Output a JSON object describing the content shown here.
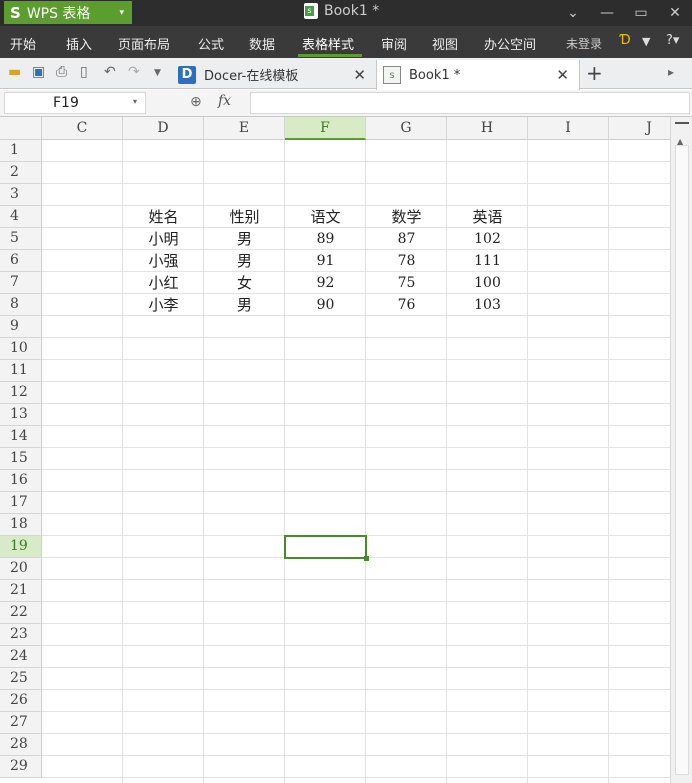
{
  "titlebar": {
    "app_logo": "S",
    "app_name": "WPS 表格",
    "app_caret": "▾",
    "doc_title": "Book1 *",
    "ctrl_dropdown": "⌄",
    "ctrl_minimize": "—",
    "ctrl_maximize": "▭",
    "ctrl_close": "✕"
  },
  "menu": {
    "items": [
      "开始",
      "插入",
      "页面布局",
      "公式",
      "数据",
      "表格样式",
      "审阅",
      "视图",
      "办公空间"
    ],
    "active": "表格样式",
    "login": "未登录",
    "skin_icon": "Ɗ",
    "shirt_icon": "👕",
    "help": "?▾"
  },
  "toolbar": {
    "qa_icons": [
      "folder-icon",
      "save-icon",
      "print-icon",
      "print-preview-icon",
      "undo-icon",
      "redo-icon",
      "dropdown-icon"
    ],
    "tabs": [
      {
        "label": "Docer-在线模板",
        "icon": "D",
        "close": "✕"
      },
      {
        "label": "Book1 *",
        "icon": "s",
        "close": "✕"
      }
    ],
    "new_tab": "+",
    "right_icon": "▸"
  },
  "formula_bar": {
    "name_box": "F19",
    "caret": "▾",
    "zoom_icon": "🔍",
    "fx": "fx",
    "formula": ""
  },
  "sheet": {
    "columns": [
      "C",
      "D",
      "E",
      "F",
      "G",
      "H",
      "I",
      "J"
    ],
    "selected_column": "F",
    "rows": [
      "1",
      "2",
      "3",
      "4",
      "5",
      "6",
      "7",
      "8",
      "9",
      "10",
      "11",
      "12",
      "13",
      "14",
      "15",
      "16",
      "17",
      "18",
      "19",
      "20",
      "21",
      "22",
      "23",
      "24",
      "25",
      "26",
      "27",
      "28",
      "29"
    ],
    "selected_row": "19",
    "table": {
      "headers": [
        "姓名",
        "性别",
        "语文",
        "数学",
        "英语"
      ],
      "rows": [
        [
          "小明",
          "男",
          "89",
          "87",
          "102"
        ],
        [
          "小强",
          "男",
          "91",
          "78",
          "111"
        ],
        [
          "小红",
          "女",
          "92",
          "75",
          "100"
        ],
        [
          "小李",
          "男",
          "90",
          "76",
          "103"
        ]
      ]
    },
    "active_cell": "F19"
  },
  "colors": {
    "accent": "#5b9d2e",
    "titlebar_bg": "#2d2d2d",
    "menubar_bg": "#3a3a3a"
  }
}
